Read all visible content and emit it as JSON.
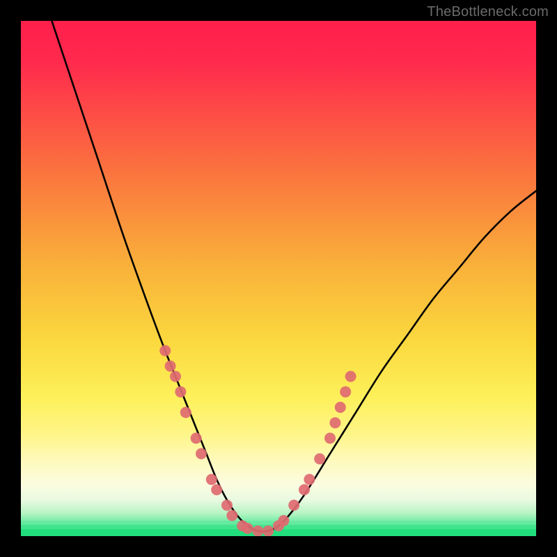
{
  "watermark": "TheBottleneck.com",
  "colors": {
    "black": "#000000",
    "curve": "#000000",
    "marker_fill": "#e06a71",
    "marker_stroke": "#c9555c",
    "green_band": "#26e07e",
    "green_band_2": "#4ce892",
    "yellow": "#f9e94e",
    "orange": "#f9a23a",
    "red": "#ff2a4d"
  },
  "chart_data": {
    "type": "line",
    "title": "",
    "xlabel": "",
    "ylabel": "",
    "xlim": [
      0,
      100
    ],
    "ylim": [
      0,
      100
    ],
    "grid": false,
    "legend": false,
    "series": [
      {
        "name": "bottleneck-curve",
        "x": [
          6,
          10,
          15,
          20,
          25,
          28,
          30,
          32,
          34,
          36,
          38,
          40,
          42,
          44,
          46,
          48,
          50,
          52,
          55,
          60,
          65,
          70,
          75,
          80,
          85,
          90,
          95,
          100
        ],
        "y": [
          100,
          88,
          73,
          58,
          44,
          36,
          31,
          26,
          21,
          16,
          11,
          7,
          4,
          2,
          1,
          1,
          2,
          4,
          8,
          16,
          24,
          32,
          39,
          46,
          52,
          58,
          63,
          67
        ]
      }
    ],
    "markers": {
      "name": "highlight-points",
      "points": [
        {
          "x": 28,
          "y": 36
        },
        {
          "x": 29,
          "y": 33
        },
        {
          "x": 30,
          "y": 31
        },
        {
          "x": 31,
          "y": 28
        },
        {
          "x": 32,
          "y": 24
        },
        {
          "x": 34,
          "y": 19
        },
        {
          "x": 35,
          "y": 16
        },
        {
          "x": 37,
          "y": 11
        },
        {
          "x": 38,
          "y": 9
        },
        {
          "x": 40,
          "y": 6
        },
        {
          "x": 41,
          "y": 4
        },
        {
          "x": 43,
          "y": 2
        },
        {
          "x": 44,
          "y": 1.5
        },
        {
          "x": 46,
          "y": 1
        },
        {
          "x": 48,
          "y": 1
        },
        {
          "x": 50,
          "y": 2
        },
        {
          "x": 51,
          "y": 3
        },
        {
          "x": 53,
          "y": 6
        },
        {
          "x": 55,
          "y": 9
        },
        {
          "x": 56,
          "y": 11
        },
        {
          "x": 58,
          "y": 15
        },
        {
          "x": 60,
          "y": 19
        },
        {
          "x": 61,
          "y": 22
        },
        {
          "x": 62,
          "y": 25
        },
        {
          "x": 63,
          "y": 28
        },
        {
          "x": 64,
          "y": 31
        }
      ]
    },
    "bands": [
      {
        "name": "green",
        "y0": 0,
        "y1": 3
      },
      {
        "name": "cream",
        "y0": 3,
        "y1": 22
      }
    ]
  }
}
